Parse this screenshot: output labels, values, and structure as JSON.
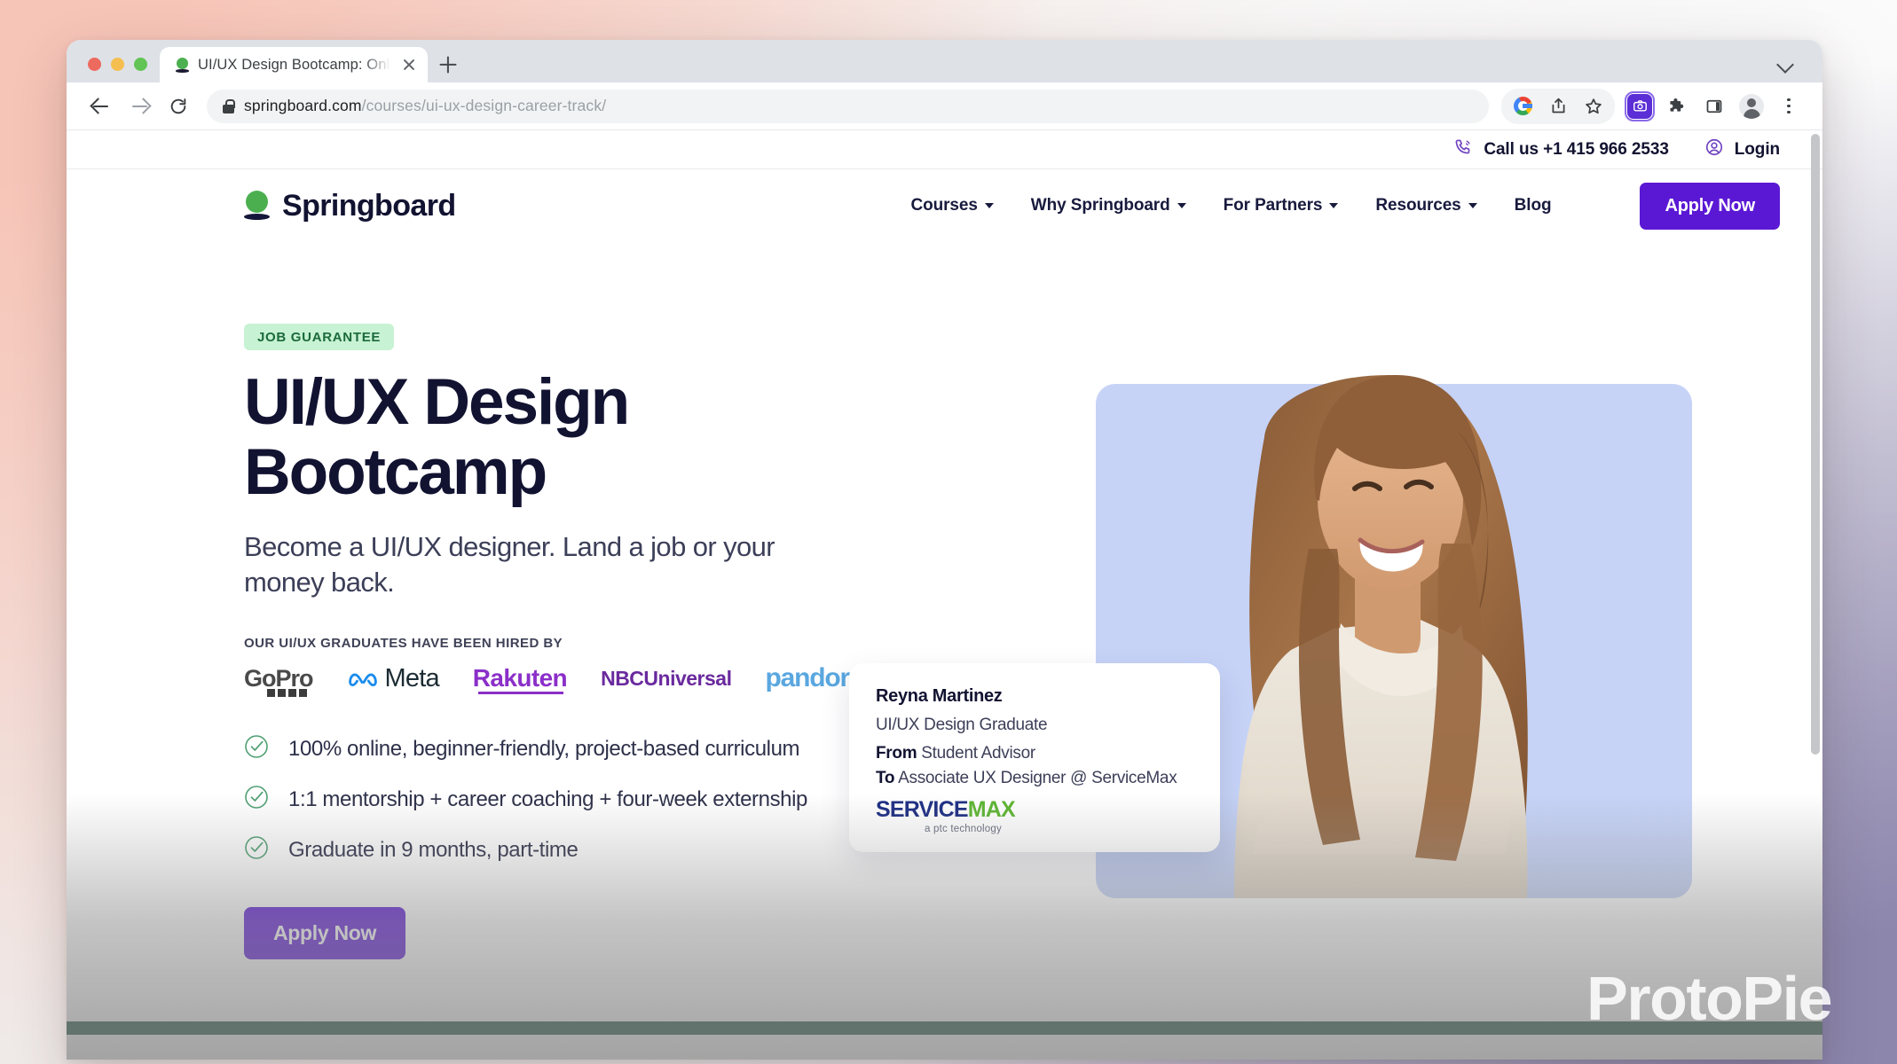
{
  "browser": {
    "tab": {
      "title": "UI/UX Design Bootcamp: Online",
      "favicon": "springboard-favicon-icon",
      "close": "close-tab-icon"
    },
    "new_tab_label": "+",
    "url_prefix": "springboard.com",
    "url_suffix": "/courses/ui-ux-design-career-track/",
    "toolbar_icons": [
      "google-search-icon",
      "share-icon",
      "bookmark-star-icon",
      "screenshot-extension-icon",
      "extensions-puzzle-icon",
      "side-panel-icon",
      "profile-avatar-icon",
      "chrome-menu-kebab-icon"
    ],
    "nav_icons": [
      "back-arrow-icon",
      "forward-arrow-icon",
      "reload-icon"
    ],
    "tab_search_icon": "chevron-down-icon",
    "lock_icon": "lock-icon"
  },
  "utility": {
    "phone_icon": "phone-icon",
    "phone_label": "Call us +1 415 966 2533",
    "login_icon": "user-circle-icon",
    "login_label": "Login"
  },
  "header": {
    "brand": "Springboard",
    "nav": [
      {
        "label": "Courses",
        "has_caret": true
      },
      {
        "label": "Why Springboard",
        "has_caret": true
      },
      {
        "label": "For Partners",
        "has_caret": true
      },
      {
        "label": "Resources",
        "has_caret": true
      },
      {
        "label": "Blog",
        "has_caret": false
      }
    ],
    "apply_label": "Apply Now"
  },
  "hero": {
    "badge": "JOB GUARANTEE",
    "title_line1": "UI/UX Design",
    "title_line2": "Bootcamp",
    "subtitle": "Become a UI/UX designer. Land a job or your money back.",
    "hired_label": "OUR UI/UX GRADUATES HAVE BEEN HIRED BY",
    "employers": [
      "GoPro",
      "Meta",
      "Rakuten",
      "NBCUniversal",
      "pandora"
    ],
    "features": [
      "100% online, beginner-friendly, project-based curriculum",
      "1:1 mentorship + career coaching + four-week externship",
      "Graduate in 9 months, part-time"
    ],
    "feature_icon": "check-circle-icon",
    "cta_label": "Apply Now"
  },
  "testimonial": {
    "name": "Reyna Martinez",
    "role": "UI/UX Design Graduate",
    "from_label": "From",
    "from_value": "Student Advisor",
    "to_label": "To",
    "to_value": "Associate UX Designer @ ServiceMax",
    "company_part1": "SERVICE",
    "company_part2": "MAX",
    "company_tagline": "a ptc technology"
  },
  "watermark": "ProtoPie",
  "colors": {
    "brand_purple": "#5b18d4",
    "brand_green": "#4caf4f",
    "ink": "#121331",
    "badge_bg": "#c8f2d4",
    "badge_text": "#1b6a3b",
    "hero_card": "#c6d3f7",
    "band_green": "#1f5240"
  }
}
